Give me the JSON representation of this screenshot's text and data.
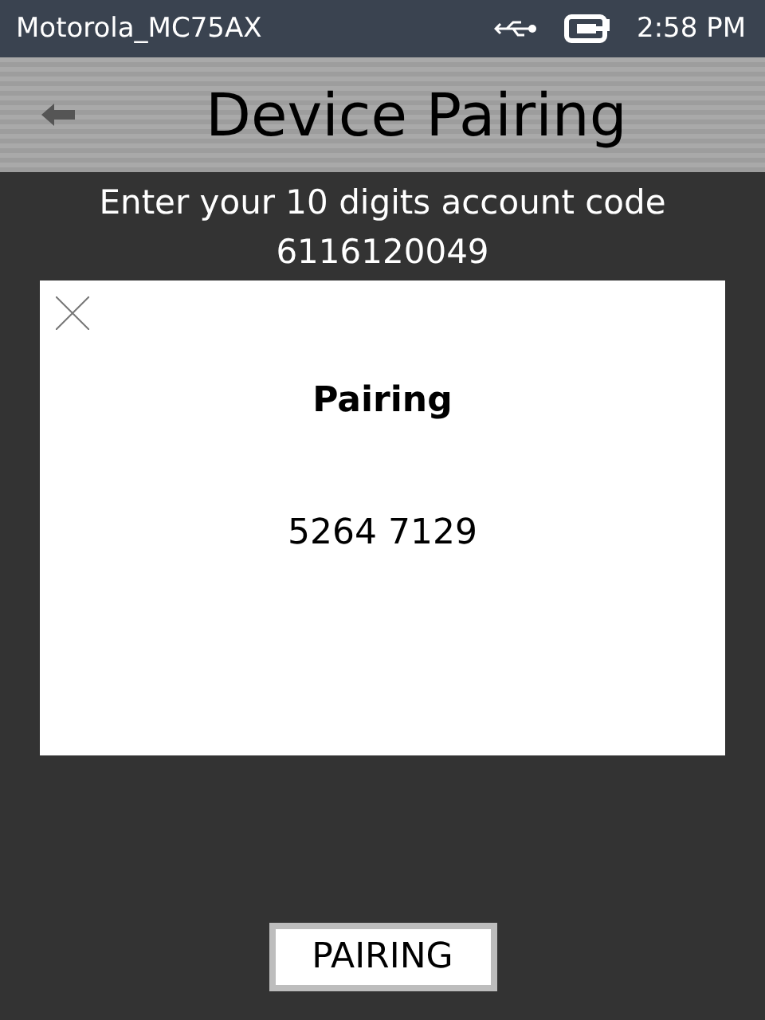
{
  "status_bar": {
    "device": "Motorola_MC75AX",
    "time": "2:58 PM"
  },
  "header": {
    "title": "Device Pairing"
  },
  "prompt": "Enter your 10 digits account code",
  "account_code": "6116120049",
  "dialog": {
    "title": "Pairing",
    "code": "5264 7129"
  },
  "button": "PAIRING"
}
